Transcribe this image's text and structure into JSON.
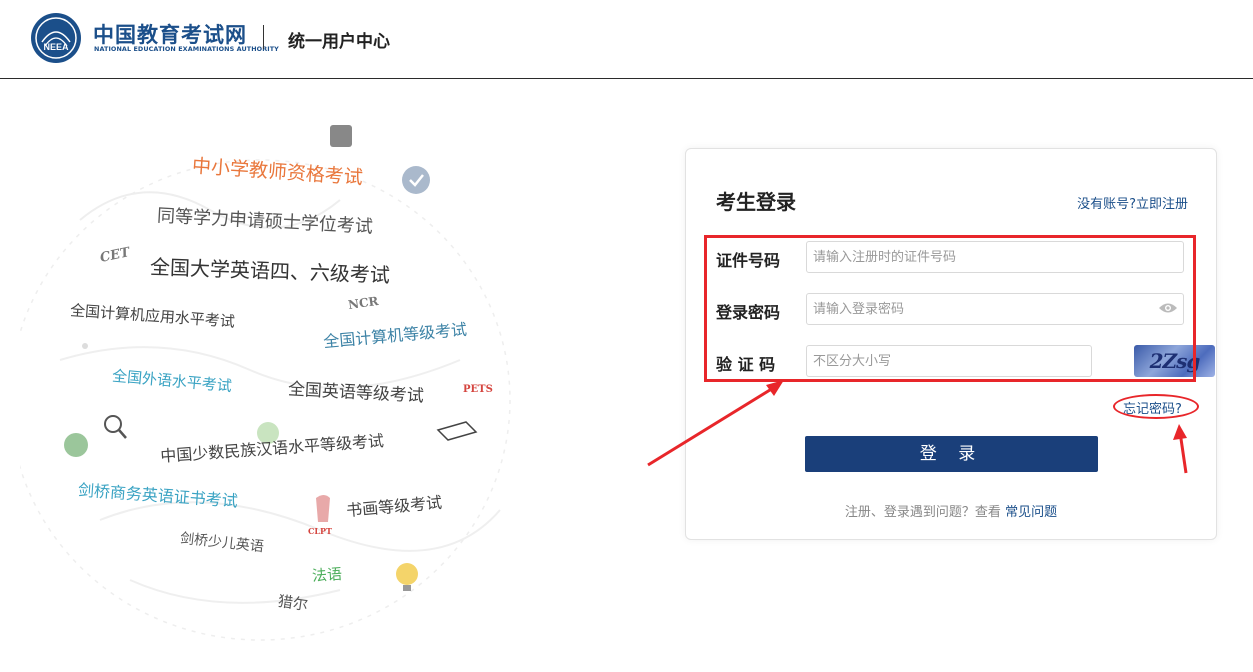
{
  "header": {
    "logo_cn": "中国教育考试网",
    "logo_en": "NATIONAL EDUCATION EXAMINATIONS AUTHORITY",
    "logo_emblem_text": "NEEA",
    "center_title": "统一用户中心"
  },
  "illustration": {
    "exams": [
      "中小学教师资格考试",
      "同等学力申请硕士学位考试",
      "全国大学英语四、六级考试",
      "全国计算机应用水平考试",
      "全国计算机等级考试",
      "全国外语水平考试",
      "全国英语等级考试",
      "中国少数民族汉语水平等级考试",
      "剑桥商务英语证书考试",
      "书画等级考试",
      "剑桥少儿英语",
      "法语",
      "猎尔"
    ],
    "badges": [
      "CET",
      "NCR",
      "PETS",
      "CLPT"
    ]
  },
  "login": {
    "title": "考生登录",
    "register_link": "没有账号?立即注册",
    "id_label": "证件号码",
    "id_placeholder": "请输入注册时的证件号码",
    "password_label": "登录密码",
    "password_placeholder": "请输入登录密码",
    "captcha_label": "验 证 码",
    "captcha_placeholder": "不区分大小写",
    "captcha_text": "2Zsg",
    "forgot_link": "忘记密码?",
    "login_button": "登 录",
    "help_text": "注册、登录遇到问题？查看",
    "help_link": "常见问题"
  },
  "colors": {
    "brand": "#1b4f8a",
    "button": "#1a3f7a",
    "annotation": "#e8262a"
  }
}
